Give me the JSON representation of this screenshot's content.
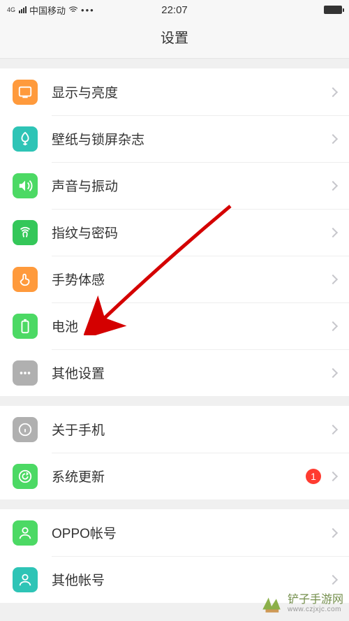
{
  "status": {
    "network_type": "4G",
    "carrier": "中国移动",
    "time": "22:07"
  },
  "header": {
    "title": "设置"
  },
  "groups": [
    {
      "rows": [
        {
          "key": "display",
          "label": "显示与亮度"
        },
        {
          "key": "wallpaper",
          "label": "壁纸与锁屏杂志"
        },
        {
          "key": "sound",
          "label": "声音与振动"
        },
        {
          "key": "fingerprint",
          "label": "指纹与密码"
        },
        {
          "key": "gesture",
          "label": "手势体感"
        },
        {
          "key": "battery",
          "label": "电池"
        },
        {
          "key": "other",
          "label": "其他设置"
        }
      ]
    },
    {
      "rows": [
        {
          "key": "about",
          "label": "关于手机"
        },
        {
          "key": "update",
          "label": "系统更新",
          "badge": "1"
        }
      ]
    },
    {
      "rows": [
        {
          "key": "oppo",
          "label": "OPPO帐号"
        },
        {
          "key": "accounts",
          "label": "其他帐号"
        }
      ]
    }
  ],
  "watermark": {
    "name": "铲子手游网",
    "url": "www.czjxjc.com"
  }
}
